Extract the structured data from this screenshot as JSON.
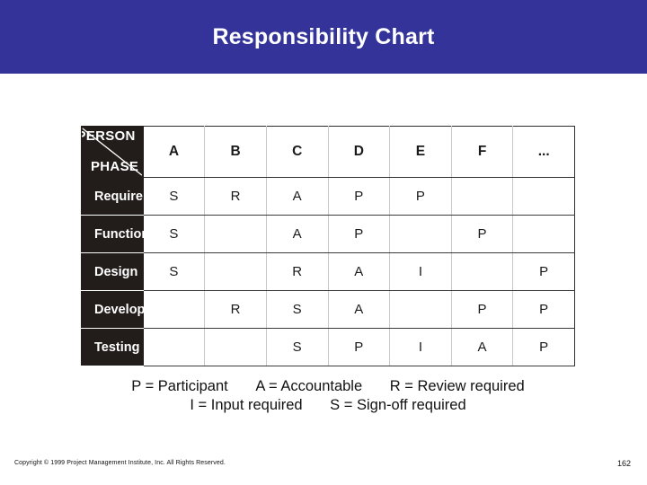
{
  "slide": {
    "title": "Responsibility Chart",
    "banner_color": "#33339a",
    "title_color": "#ffffff"
  },
  "table": {
    "corner": {
      "person_label": "PERSON",
      "phase_label": "PHASE",
      "dark_cell_color": "#221d1a"
    },
    "columns": [
      "A",
      "B",
      "C",
      "D",
      "E",
      "F",
      "..."
    ],
    "rows": [
      {
        "phase": "Requirements",
        "cells": [
          "S",
          "R",
          "A",
          "P",
          "P",
          "",
          ""
        ]
      },
      {
        "phase": "Functional",
        "cells": [
          "S",
          "",
          "A",
          "P",
          "",
          "P",
          ""
        ]
      },
      {
        "phase": "Design",
        "cells": [
          "S",
          "",
          "R",
          "A",
          "I",
          "",
          "P"
        ]
      },
      {
        "phase": "Development",
        "cells": [
          "",
          "R",
          "S",
          "A",
          "",
          "P",
          "P"
        ]
      },
      {
        "phase": "Testing",
        "cells": [
          "",
          "",
          "S",
          "P",
          "I",
          "A",
          "P"
        ]
      }
    ]
  },
  "legend": {
    "line1": [
      "P = Participant",
      "A = Accountable",
      "R = Review required"
    ],
    "line2": [
      "I = Input required",
      "S = Sign-off required"
    ]
  },
  "footer": {
    "copyright": "Copyright © 1999 Project Management Institute, Inc. All Rights Reserved.",
    "page_number": "162"
  }
}
